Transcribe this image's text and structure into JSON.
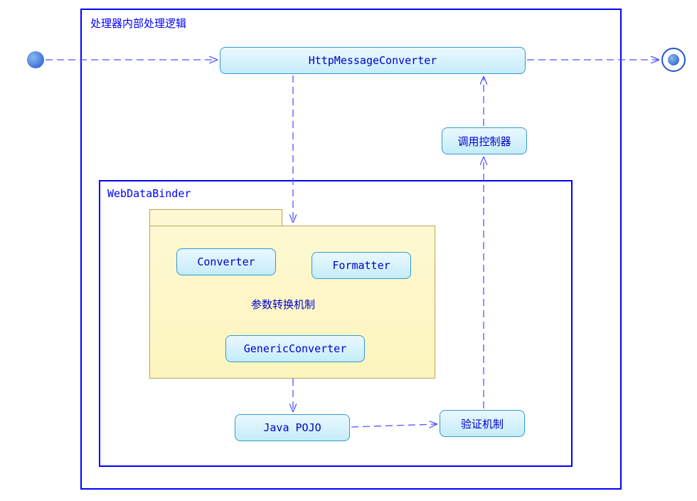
{
  "diagram": {
    "outer_title": "处理器内部处理逻辑",
    "inner_title": "WebDataBinder",
    "nodes": {
      "http_converter": "HttpMessageConverter",
      "invoke_controller": "调用控制器",
      "converter": "Converter",
      "formatter": "Formatter",
      "generic_converter": "GenericConverter",
      "folder_label": "参数转换机制",
      "java_pojo": "Java POJO",
      "validation": "验证机制"
    }
  }
}
